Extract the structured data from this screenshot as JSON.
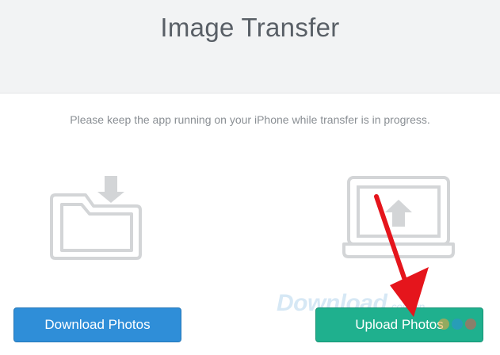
{
  "header": {
    "title": "Image Transfer"
  },
  "main": {
    "message": "Please keep the app running on your iPhone while transfer is in progress."
  },
  "buttons": {
    "download_label": "Download Photos",
    "upload_label": "Upload Photos"
  },
  "watermark": {
    "text": "Download",
    "domain": ".com.vn"
  },
  "icons": {
    "download": "folder-download-icon",
    "upload": "laptop-upload-icon",
    "annotation": "red-arrow"
  },
  "colors": {
    "download_button": "#2f8ed8",
    "upload_button": "#1fb08e",
    "icon_gray": "#d3d5d7",
    "arrow_red": "#e5151c",
    "dot_orange": "#f2a53a",
    "dot_blue": "#2f8ed8",
    "dot_red": "#e2574c"
  }
}
